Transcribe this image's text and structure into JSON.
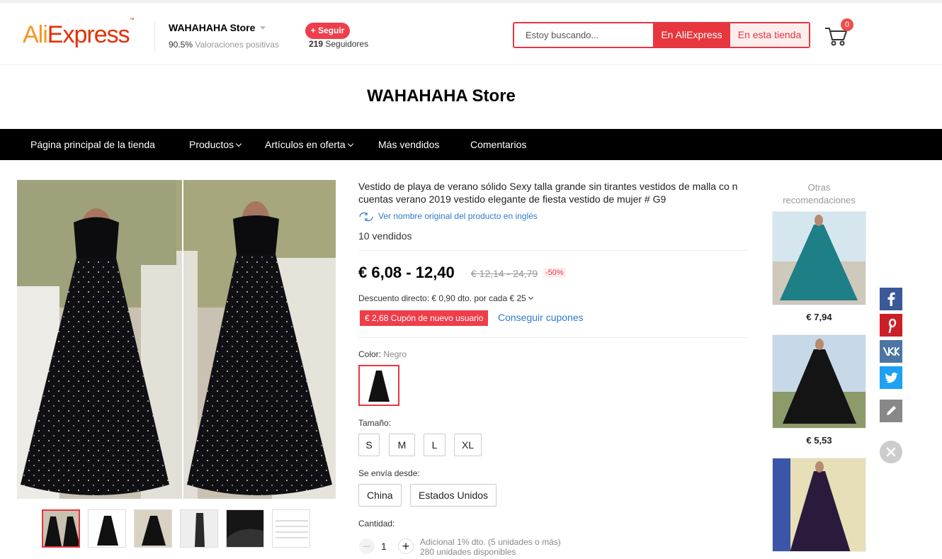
{
  "header": {
    "logo": {
      "part1": "Ali",
      "part2": "Express",
      "tm": "™"
    },
    "store": {
      "name": "WAHAHAHA Store",
      "rating_value": "90.5%",
      "rating_label": "Valoraciones positivas",
      "follow_label": "+ Seguir",
      "followers_count": "219",
      "followers_label": "Seguidores"
    },
    "search": {
      "placeholder": "Estoy buscando...",
      "btn_global": "En AliExpress",
      "btn_store": "En esta tienda"
    },
    "cart": {
      "count": "0"
    }
  },
  "store_title": "WAHAHAHA Store",
  "nav": {
    "items": [
      {
        "label": "Página principal de la tienda"
      },
      {
        "label": "Productos"
      },
      {
        "label": "Artículos en oferta"
      },
      {
        "label": "Más vendidos"
      },
      {
        "label": "Comentarios"
      }
    ]
  },
  "product": {
    "title": "Vestido de playa de verano sólido Sexy talla grande sin tirantes vestidos de malla co n cuentas verano 2019 vestido elegante de fiesta vestido de mujer # G9",
    "translate_link": "Ver nombre original del producto en inglés",
    "sold": "10 vendidos",
    "price": "€ 6,08 - 12,40",
    "original_price": "€ 12,14 - 24,79",
    "discount": "-50%",
    "direct_discount": "Descuento directo: € 0,90 dto. por cada € 25",
    "coupon": "€ 2,68 Cupón de nuevo usuario",
    "coupon_link": "Conseguir cupones",
    "color_label": "Color:",
    "color_value": "Negro",
    "size_label": "Tamaño:",
    "sizes": [
      "S",
      "M",
      "L",
      "XL"
    ],
    "ship_label": "Se envía desde:",
    "ship_from": [
      "China",
      "Estados Unidos"
    ],
    "qty_label": "Cantidad:",
    "qty_value": "1",
    "qty_minus": "–",
    "qty_plus": "+",
    "qty_note1": "Adicional 1% dto. (5 unidades o más)",
    "qty_note2": "280 unidades disponibles"
  },
  "recommendations": {
    "title": "Otras recomendaciones",
    "items": [
      {
        "price": "€ 7,94",
        "dress_color": "#1f7f86"
      },
      {
        "price": "€ 5,53",
        "dress_color": "#141414"
      },
      {
        "price": "",
        "dress_color": "#2a1a3c"
      }
    ]
  },
  "social": [
    "facebook-icon",
    "pinterest-icon",
    "vk-icon",
    "twitter-icon",
    "edit-icon",
    "close-icon"
  ],
  "colors": {
    "accent": "#e8363f",
    "link": "#2e7bcc",
    "facebook": "#3b5998",
    "pinterest": "#cb2027",
    "vk": "#4c75a3",
    "twitter": "#1da1f2",
    "edit": "#888888"
  }
}
